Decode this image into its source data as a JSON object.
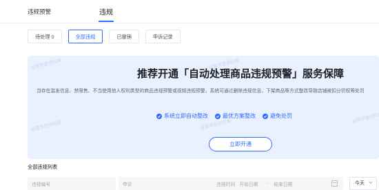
{
  "top_tabs": [
    {
      "label": "违规预警"
    },
    {
      "label": "违规",
      "active": true
    }
  ],
  "sub_tabs": [
    {
      "label": "待处理 0"
    },
    {
      "label": "全部违规",
      "active": true
    },
    {
      "label": "已撤销"
    },
    {
      "label": "申诉记录"
    }
  ],
  "banner": {
    "title": "推荐开通「自动处理商品违规预警」服务保障",
    "description": "当存在滥发信息、禁限售、不当使用他人权利类型的商品违规预警或视频违规预警，系统可通过删除违规信息、下架商品等方式整改导致店铺被扣分罚权等处罚",
    "benefits": [
      "系统立即自动整改",
      "最优方案整改",
      "避免处罚"
    ],
    "cta": "立即开通",
    "watermark": "运营学堂资料库"
  },
  "list": {
    "title": "全部违规列表",
    "filters": {
      "id_placeholder": "违规编号",
      "appeal_label": "申诉",
      "time_label": "违规时间",
      "start_placeholder": "开始日期",
      "arrow": "→",
      "end_placeholder": "结束日期",
      "quick_range": "今天"
    }
  },
  "colors": {
    "accent": "#2f6bff",
    "banner_bg": "#e9f1ff"
  }
}
